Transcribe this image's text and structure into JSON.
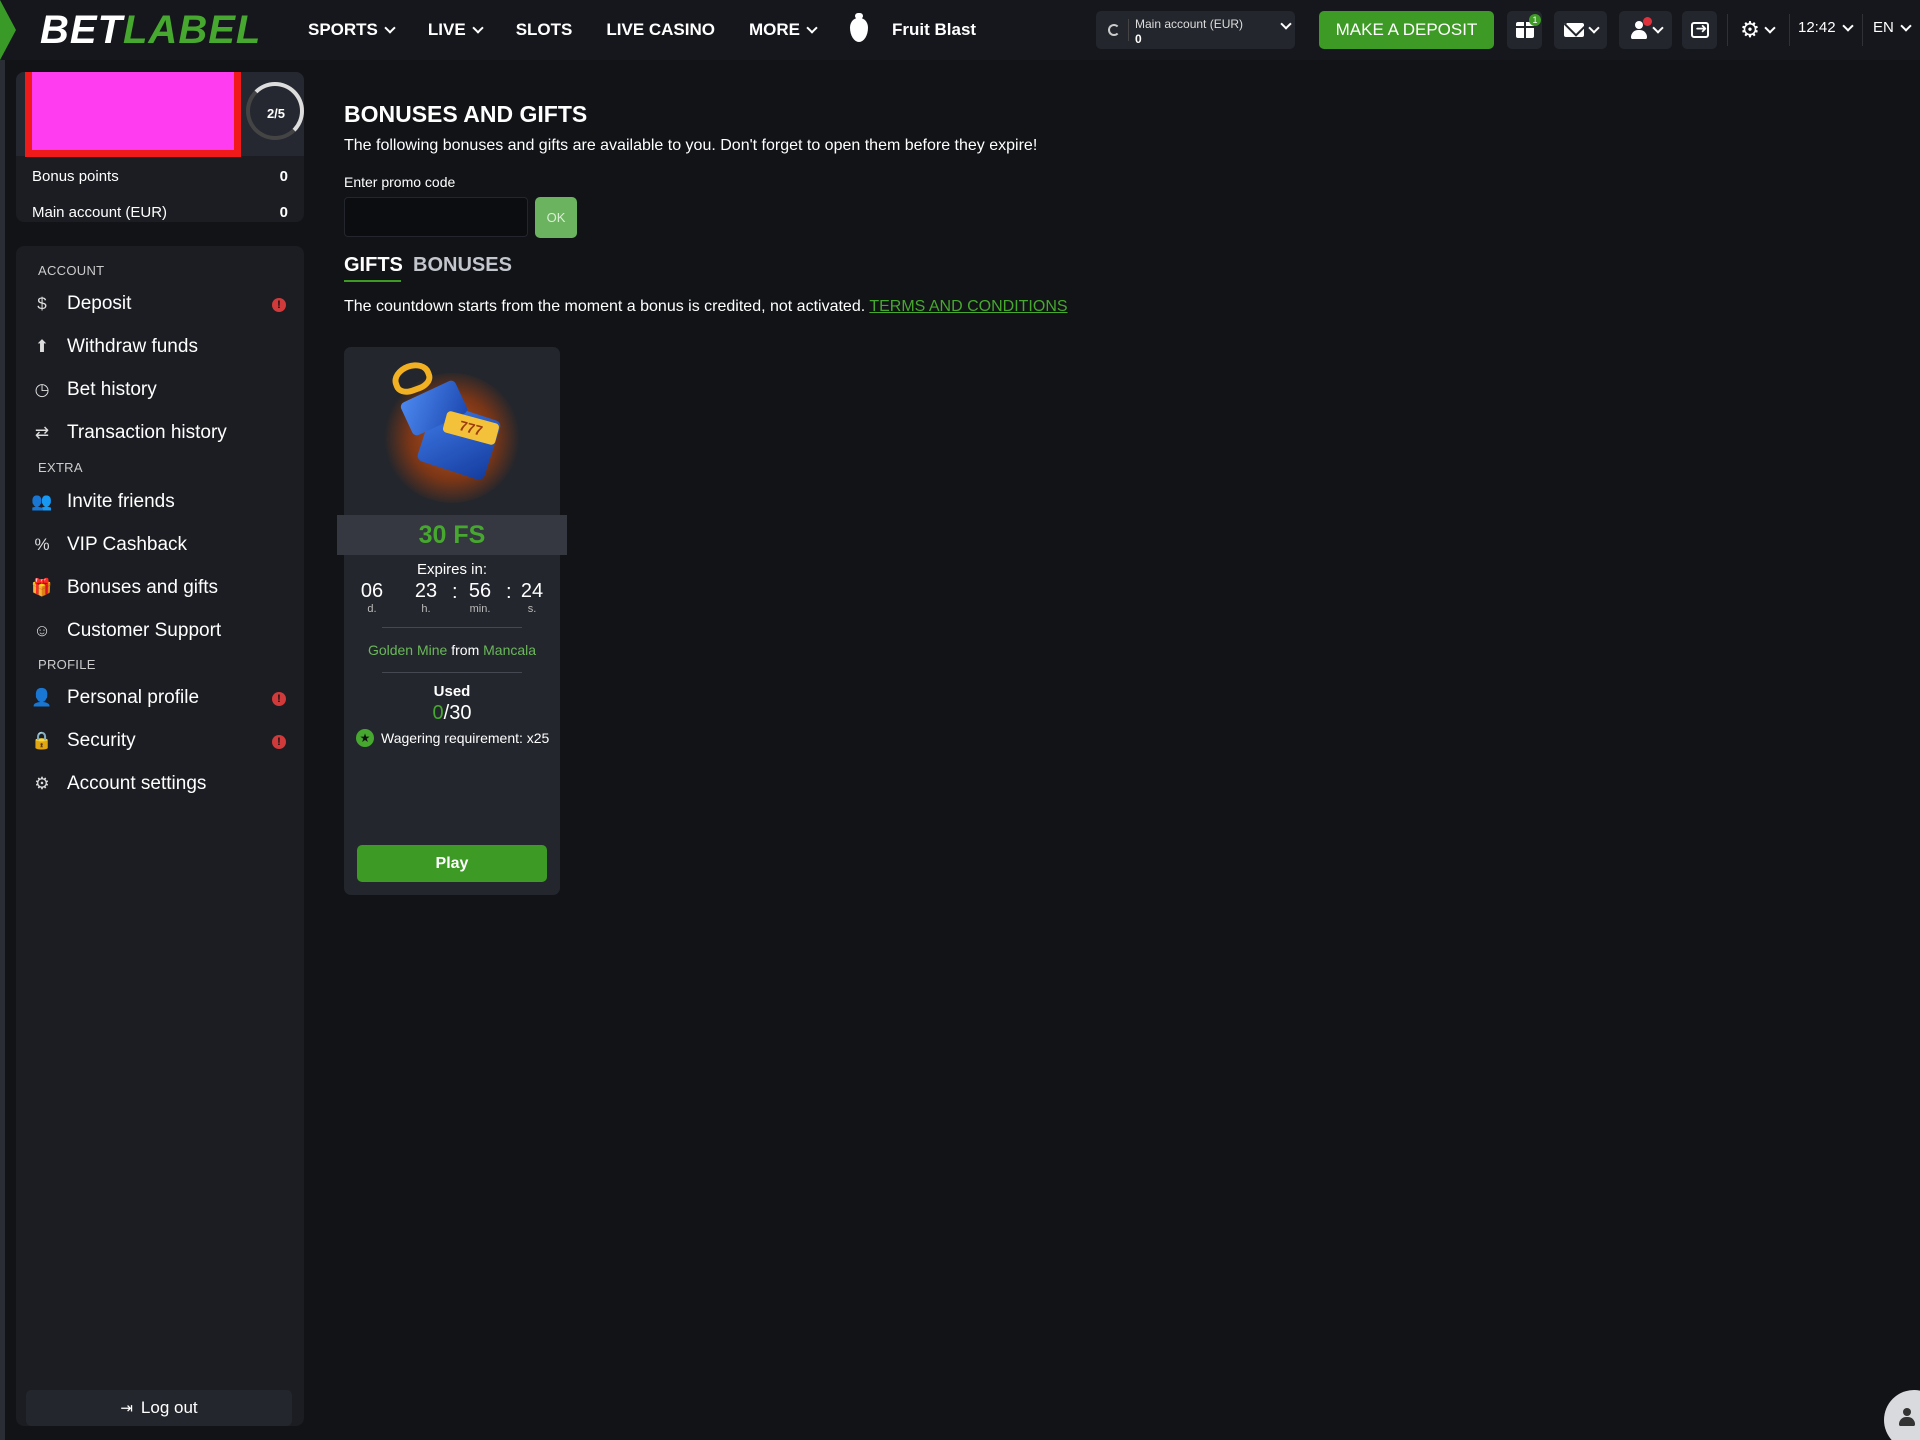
{
  "brand": {
    "part1": "BET",
    "part2": "LABEL"
  },
  "nav": {
    "items": [
      {
        "label": "SPORTS",
        "dropdown": true
      },
      {
        "label": "LIVE",
        "dropdown": true
      },
      {
        "label": "SLOTS",
        "dropdown": false
      },
      {
        "label": "LIVE CASINO",
        "dropdown": false
      },
      {
        "label": "MORE",
        "dropdown": true
      }
    ],
    "featured_game": "Fruit Blast"
  },
  "header": {
    "account_label": "Main account  (EUR)",
    "account_value": "0",
    "deposit_button": "MAKE A DEPOSIT",
    "gift_badge": "1",
    "time": "12:42",
    "language": "EN"
  },
  "profile": {
    "level_progress": "2/5",
    "bonus_points_label": "Bonus points",
    "bonus_points_value": "0",
    "main_account_label": "Main account (EUR)",
    "main_account_value": "0"
  },
  "sidebar": {
    "sections": {
      "account": "ACCOUNT",
      "extra": "EXTRA",
      "profile": "PROFILE"
    },
    "items": {
      "deposit": "Deposit",
      "withdraw": "Withdraw funds",
      "bet_history": "Bet history",
      "transaction_history": "Transaction history",
      "invite_friends": "Invite friends",
      "vip_cashback": "VIP Cashback",
      "bonuses_gifts": "Bonuses and gifts",
      "customer_support": "Customer Support",
      "personal_profile": "Personal profile",
      "security": "Security",
      "account_settings": "Account settings"
    },
    "alert_symbol": "!",
    "logout": "Log out"
  },
  "main": {
    "title": "BONUSES AND GIFTS",
    "subtitle": "The following bonuses and gifts are available to you. Don't forget to open them before they expire!",
    "promo_label": "Enter promo code",
    "promo_value": "",
    "ok_button": "OK",
    "tabs": {
      "gifts": "GIFTS",
      "bonuses": "BONUSES"
    },
    "countdown_note": "The countdown starts from the moment a bonus is credited, not activated.",
    "terms_link": "TERMS AND CONDITIONS"
  },
  "gift_card": {
    "amount": "30 FS",
    "expires_label": "Expires in:",
    "timer": {
      "days": "06",
      "days_label": "d.",
      "hours": "23",
      "hours_label": "h.",
      "minutes": "56",
      "minutes_label": "min.",
      "seconds": "24",
      "seconds_label": "s."
    },
    "game": "Golden Mine",
    "from_word": "from",
    "provider": "Mancala",
    "used_label": "Used",
    "used_count": "0",
    "used_total": "/30",
    "wagering": "Wagering requirement: x25",
    "play_button": "Play",
    "slot_digits": "777"
  },
  "colors": {
    "accent": "#3d9a25",
    "alert": "#d03a3a",
    "background": "#111317",
    "card": "#23262c"
  }
}
